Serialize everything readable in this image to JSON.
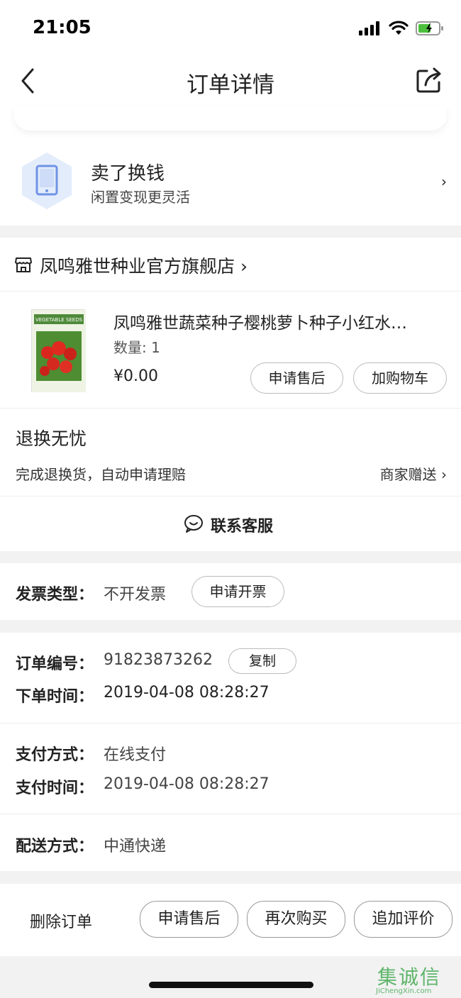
{
  "status_bar": {
    "time": "21:05"
  },
  "nav": {
    "title": "订单详情"
  },
  "promo": {
    "title": "卖了换钱",
    "subtitle": "闲置变现更灵活",
    "chevron": "›"
  },
  "store": {
    "name": "凤鸣雅世种业官方旗舰店 ›"
  },
  "product": {
    "title": "凤鸣雅世蔬菜种子樱桃萝卜种子小红水…",
    "qty": "数量: 1",
    "price": "¥0.00",
    "after_sale_btn": "申请售后",
    "cart_btn": "加购物车",
    "pack_label": "VEGETABLE SEEDS"
  },
  "guarantee": {
    "title": "退换无忧",
    "desc": "完成退换货，自动申请理赔",
    "badge": "商家赠送 ›"
  },
  "service": {
    "label": "联系客服"
  },
  "invoice": {
    "label": "发票类型：",
    "value": "不开发票",
    "button": "申请开票"
  },
  "order": {
    "id_label": "订单编号：",
    "id_value": "91823873262",
    "copy_btn": "复制",
    "time_label": "下单时间：",
    "time_value": "2019-04-08 08:28:27"
  },
  "payment": {
    "method_label": "支付方式：",
    "method_value": "在线支付",
    "time_label": "支付时间：",
    "time_value": "2019-04-08 08:28:27"
  },
  "delivery": {
    "label": "配送方式：",
    "value": "中通快递"
  },
  "bottom": {
    "delete": "删除订单",
    "after_sale": "申请售后",
    "rebuy": "再次购买",
    "review": "追加评价"
  },
  "watermark": {
    "brand": "集诚信",
    "url": "JiChengXin.com"
  },
  "colors": {
    "accent_green": "#4cc03d",
    "watermark_green": "#3aa64a"
  }
}
